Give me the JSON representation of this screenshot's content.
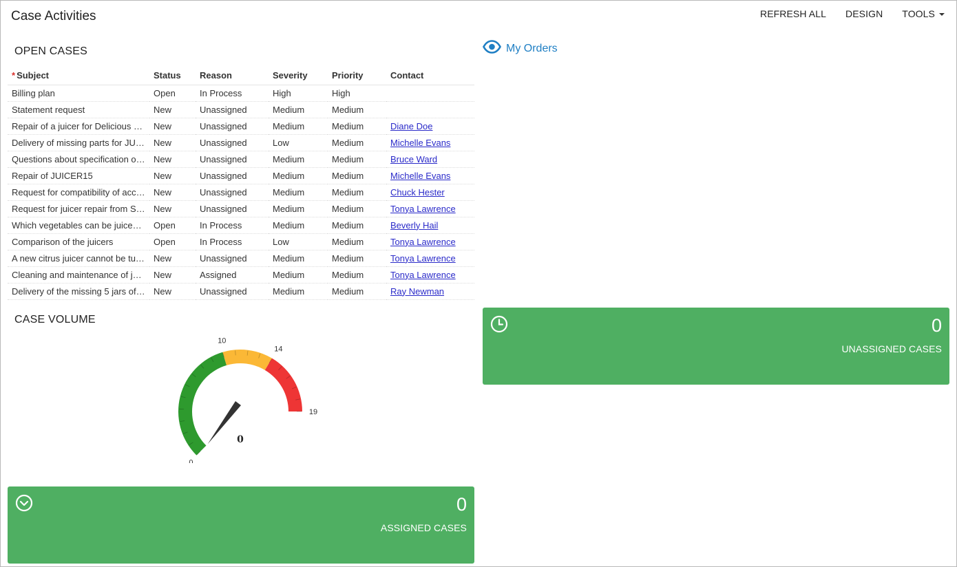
{
  "header": {
    "title": "Case Activities",
    "refresh_all": "REFRESH ALL",
    "design": "DESIGN",
    "tools": "TOOLS"
  },
  "open_cases": {
    "title": "OPEN CASES",
    "required_mark": "*",
    "columns": [
      "Subject",
      "Status",
      "Reason",
      "Severity",
      "Priority",
      "Contact"
    ],
    "rows": [
      {
        "subject": "Billing plan",
        "status": "Open",
        "reason": "In Process",
        "severity": "High",
        "priority": "High",
        "contact": ""
      },
      {
        "subject": "Statement request",
        "status": "New",
        "reason": "Unassigned",
        "severity": "Medium",
        "priority": "Medium",
        "contact": ""
      },
      {
        "subject": "Repair of a juicer for Delicious …",
        "status": "New",
        "reason": "Unassigned",
        "severity": "Medium",
        "priority": "Medium",
        "contact": "Diane Doe"
      },
      {
        "subject": "Delivery of missing parts for JU…",
        "status": "New",
        "reason": "Unassigned",
        "severity": "Low",
        "priority": "Medium",
        "contact": "Michelle Evans"
      },
      {
        "subject": "Questions about specification o…",
        "status": "New",
        "reason": "Unassigned",
        "severity": "Medium",
        "priority": "Medium",
        "contact": "Bruce Ward"
      },
      {
        "subject": "Repair of JUICER15",
        "status": "New",
        "reason": "Unassigned",
        "severity": "Medium",
        "priority": "Medium",
        "contact": "Michelle Evans"
      },
      {
        "subject": "Request for compatibility of acc…",
        "status": "New",
        "reason": "Unassigned",
        "severity": "Medium",
        "priority": "Medium",
        "contact": "Chuck Hester"
      },
      {
        "subject": "Request for juicer repair from S…",
        "status": "New",
        "reason": "Unassigned",
        "severity": "Medium",
        "priority": "Medium",
        "contact": "Tonya Lawrence"
      },
      {
        "subject": "Which vegetables can be juice…",
        "status": "Open",
        "reason": "In Process",
        "severity": "Medium",
        "priority": "Medium",
        "contact": "Beverly Hail"
      },
      {
        "subject": "Comparison of the juicers",
        "status": "Open",
        "reason": "In Process",
        "severity": "Low",
        "priority": "Medium",
        "contact": "Tonya Lawrence"
      },
      {
        "subject": "A new citrus juicer cannot be tu…",
        "status": "New",
        "reason": "Unassigned",
        "severity": "Medium",
        "priority": "Medium",
        "contact": "Tonya Lawrence"
      },
      {
        "subject": "Cleaning and maintenance of j…",
        "status": "New",
        "reason": "Assigned",
        "severity": "Medium",
        "priority": "Medium",
        "contact": "Tonya Lawrence"
      },
      {
        "subject": "Delivery of the missing 5 jars of…",
        "status": "New",
        "reason": "Unassigned",
        "severity": "Medium",
        "priority": "Medium",
        "contact": "Ray Newman"
      }
    ]
  },
  "my_orders": {
    "label": "My Orders",
    "icon": "eye-icon",
    "color": "#1f7fc4"
  },
  "case_volume": {
    "title": "CASE VOLUME",
    "gauge": {
      "min": 0,
      "max": 19,
      "value": 0,
      "value_label": "0",
      "bands": [
        {
          "from": 0,
          "to": 10,
          "color": "#2e9a2e"
        },
        {
          "from": 10,
          "to": 14,
          "color": "#fbb836"
        },
        {
          "from": 14,
          "to": 19,
          "color": "#ee3535"
        }
      ],
      "tick_labels": [
        {
          "value": 0,
          "text": "0"
        },
        {
          "value": 10,
          "text": "10"
        },
        {
          "value": 14,
          "text": "14"
        },
        {
          "value": 19,
          "text": "19"
        }
      ]
    }
  },
  "unassigned_tile": {
    "value": "0",
    "label": "UNASSIGNED CASES",
    "icon": "clock-icon",
    "color": "#4faf62"
  },
  "assigned_tile": {
    "value": "0",
    "label": "ASSIGNED CASES",
    "icon": "chevron-down-circle-icon",
    "color": "#4faf62"
  }
}
